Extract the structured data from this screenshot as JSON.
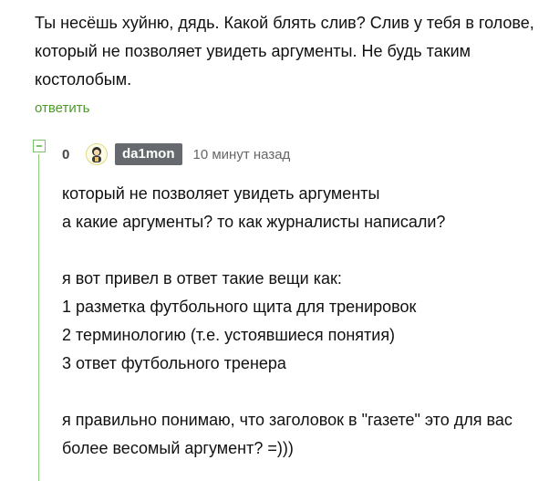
{
  "parent_comment": {
    "lines": [
      "Ты несёшь хуйню, дядь. Какой блять слив? Слив у тебя в голове,",
      "который не позволяет увидеть аргументы. Не будь таким",
      "костолобым."
    ],
    "reply_label": "ответить"
  },
  "reply_comment": {
    "rating": "0",
    "avatar_icon": "avatar-icon",
    "username": "da1mon",
    "timestamp": "10 минут назад",
    "body": "который не позволяет увидеть аргументы\nа какие аргументы? то как журналисты написали?\n\nя вот привел в ответ такие вещи как:\n1 разметка футбольного щита для тренировок\n2 терминологию (т.е. устоявшиеся понятия)\n3 ответ футбольного тренера\n\nя правильно понимаю, что заголовок в \"газете\" это для вас\nболее весомый аргумент? =)))"
  },
  "colors": {
    "accent_green": "#4c9a2a",
    "thread_line": "#8ccc7a",
    "username_bg": "#666a6e"
  }
}
